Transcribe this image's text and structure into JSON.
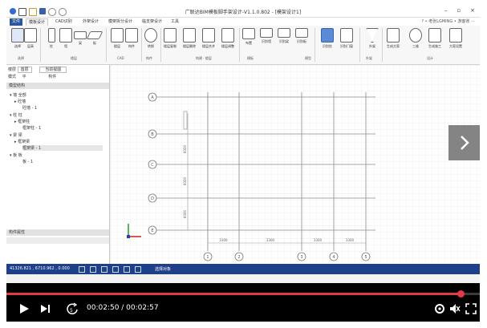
{
  "window": {
    "title": "广联达BIM模板脚手架设计-V1.1.0.802 - [模架设计1]",
    "controls": [
      "–",
      "▫",
      "×"
    ]
  },
  "ribbon_tabs": [
    "文件",
    "模板设计",
    "CAD识别",
    "外架设计",
    "模架拆分设计",
    "临支架设计",
    "工具"
  ],
  "account": {
    "text": "? • 老张LGMING • 游客账 ⋯"
  },
  "ribbon_groups": [
    "选择",
    "楼层",
    "CAD",
    "构件",
    "构建 · 楼层",
    "模板",
    "楼层",
    "模型",
    "外架",
    "设计",
    "设置"
  ],
  "ribbon_buttons": [
    "选择",
    "层高",
    "柱",
    "墙",
    "梁",
    "板",
    "楼层",
    "构件",
    "转换",
    "楼层复制",
    "楼层删除",
    "楼层合并",
    "楼层调整",
    "楼层属性",
    "布置",
    "识别墙",
    "识别梁",
    "识别板",
    "识别柱",
    "识别门窗",
    "外架",
    "生成方案",
    "三维",
    "生成施工",
    "方案设置",
    "导出"
  ],
  "left_panel": {
    "floor_label": "楼层",
    "floor_value": "首层",
    "view_label": "当前视图",
    "mode_label": "模式",
    "mode_value": "平",
    "layer_label": "构件",
    "structure_header": "模型结构",
    "tree": [
      {
        "text": "▾ 墙 全部"
      },
      {
        "text": "▸ 砼墙"
      },
      {
        "text": "砼墙 - 1"
      },
      {
        "text": "▾ 柱 柱"
      },
      {
        "text": "▸ 框架柱"
      },
      {
        "text": "框架柱 - 1"
      },
      {
        "text": "▾ 梁 梁"
      },
      {
        "text": "▸ 框架梁"
      },
      {
        "text": "框架梁 - 1"
      },
      {
        "text": "▾ 板 板"
      },
      {
        "text": "板 - 1"
      }
    ],
    "properties_header": "构件属性"
  },
  "canvas": {
    "row_axes": [
      "A",
      "B",
      "C",
      "D",
      "E"
    ],
    "col_axes": [
      "1",
      "2",
      "3",
      "4",
      "5"
    ],
    "dims_bottom": [
      "3300",
      "3300",
      "3300",
      "3300"
    ],
    "dims_left": [
      "6000",
      "6000",
      "6000"
    ]
  },
  "status": {
    "coords": "41326.821 , 6710.962 , 0.000",
    "text": "选择对象"
  },
  "video": {
    "time": "00:02:50 / 00:02:57",
    "progress_fraction": 0.96
  }
}
